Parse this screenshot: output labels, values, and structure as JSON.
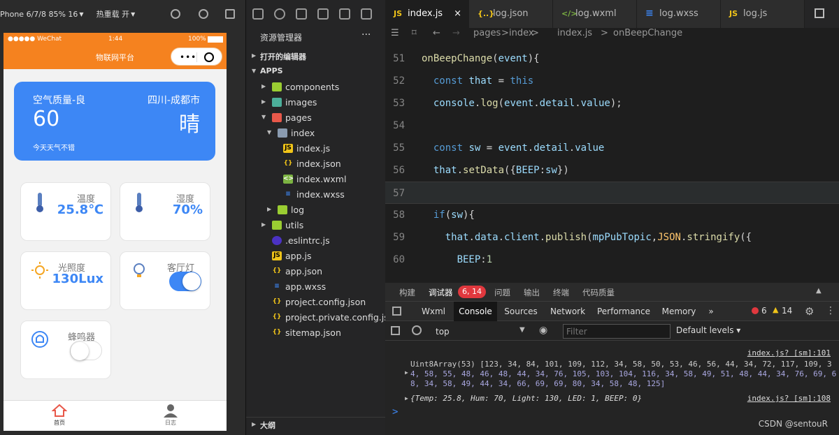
{
  "simulator": {
    "device": "Phone 6/7/8 85% 16",
    "hotreload": "热重载 开",
    "statusbar": {
      "carrier": "●●●●● WeChat",
      "time": "1:44",
      "battery": "100%"
    },
    "nav_title": "物联网平台",
    "capsule_dots": "•••",
    "weather": {
      "air": "空气质量-良",
      "city": "四川-成都市",
      "aqi": "60",
      "condition": "晴",
      "desc": "今天天气不错"
    },
    "cards": [
      {
        "label": "温度",
        "value": "25.8℃"
      },
      {
        "label": "湿度",
        "value": "70%"
      },
      {
        "label": "光照度",
        "value": "130Lux"
      },
      {
        "label": "客厅灯",
        "toggle": true
      },
      {
        "label": "蜂鸣器",
        "toggle": false
      }
    ],
    "tabs": [
      {
        "label": "首页"
      },
      {
        "label": "日志"
      }
    ],
    "colors": {
      "nav": "#f5821f",
      "accent": "#3d87f5"
    }
  },
  "explorer": {
    "title": "资源管理器",
    "more": "···",
    "open_editors": "打开的编辑器",
    "root": "APPS",
    "items": [
      {
        "name": "components"
      },
      {
        "name": "images"
      },
      {
        "name": "pages"
      },
      {
        "name": "index"
      },
      {
        "name": "index.js"
      },
      {
        "name": "index.json"
      },
      {
        "name": "index.wxml"
      },
      {
        "name": "index.wxss"
      },
      {
        "name": "log"
      },
      {
        "name": "utils"
      },
      {
        "name": ".eslintrc.js"
      },
      {
        "name": "app.js"
      },
      {
        "name": "app.json"
      },
      {
        "name": "app.wxss"
      },
      {
        "name": "project.config.json"
      },
      {
        "name": "project.private.config.js..."
      },
      {
        "name": "sitemap.json"
      }
    ],
    "outline": "大纲"
  },
  "editor": {
    "tabs": [
      {
        "label": "index.js",
        "icon": "JS"
      },
      {
        "label": "log.json",
        "icon": "{..}"
      },
      {
        "label": "log.wxml",
        "icon": "</>"
      },
      {
        "label": "log.wxss",
        "icon": "≡"
      },
      {
        "label": "log.js",
        "icon": "JS"
      }
    ],
    "close": "×",
    "breadcrumb": [
      "pages",
      "index",
      "index.js",
      "onBeepChange"
    ],
    "sep": ">",
    "code": [
      {
        "n": "51",
        "parts": [
          [
            "fn",
            "onBeepChange"
          ],
          [
            "pl",
            "("
          ],
          [
            "vr",
            "event"
          ],
          [
            "pl",
            "){"
          ]
        ]
      },
      {
        "n": "52",
        "parts": [
          [
            "pl",
            "  "
          ],
          [
            "kw",
            "const"
          ],
          [
            "pl",
            " "
          ],
          [
            "vr",
            "that"
          ],
          [
            "pl",
            " = "
          ],
          [
            "kw",
            "this"
          ]
        ]
      },
      {
        "n": "53",
        "parts": [
          [
            "pl",
            "  "
          ],
          [
            "vr",
            "console"
          ],
          [
            "pl",
            "."
          ],
          [
            "fn",
            "log"
          ],
          [
            "pl",
            "("
          ],
          [
            "vr",
            "event"
          ],
          [
            "pl",
            "."
          ],
          [
            "vr",
            "detail"
          ],
          [
            "pl",
            "."
          ],
          [
            "vr",
            "value"
          ],
          [
            "pl",
            ");"
          ]
        ]
      },
      {
        "n": "54",
        "parts": []
      },
      {
        "n": "55",
        "parts": [
          [
            "pl",
            "  "
          ],
          [
            "kw",
            "const"
          ],
          [
            "pl",
            " "
          ],
          [
            "vr",
            "sw"
          ],
          [
            "pl",
            " = "
          ],
          [
            "vr",
            "event"
          ],
          [
            "pl",
            "."
          ],
          [
            "vr",
            "detail"
          ],
          [
            "pl",
            "."
          ],
          [
            "vr",
            "value"
          ]
        ]
      },
      {
        "n": "56",
        "parts": [
          [
            "pl",
            "  "
          ],
          [
            "vr",
            "that"
          ],
          [
            "pl",
            "."
          ],
          [
            "fn",
            "setData"
          ],
          [
            "pl",
            "({"
          ],
          [
            "vr",
            "BEEP"
          ],
          [
            "pl",
            ":"
          ],
          [
            "vr",
            "sw"
          ],
          [
            "pl",
            "})"
          ]
        ]
      },
      {
        "n": "57",
        "parts": []
      },
      {
        "n": "58",
        "parts": [
          [
            "pl",
            "  "
          ],
          [
            "kw",
            "if"
          ],
          [
            "pl",
            "("
          ],
          [
            "vr",
            "sw"
          ],
          [
            "pl",
            "){"
          ]
        ]
      },
      {
        "n": "59",
        "parts": [
          [
            "pl",
            "    "
          ],
          [
            "vr",
            "that"
          ],
          [
            "pl",
            "."
          ],
          [
            "vr",
            "data"
          ],
          [
            "pl",
            "."
          ],
          [
            "vr",
            "client"
          ],
          [
            "pl",
            "."
          ],
          [
            "fn",
            "publish"
          ],
          [
            "pl",
            "("
          ],
          [
            "vr",
            "mpPubTopic"
          ],
          [
            "pl",
            ","
          ],
          [
            "cl",
            "JSON"
          ],
          [
            "pl",
            "."
          ],
          [
            "fn",
            "stringify"
          ],
          [
            "pl",
            "({"
          ]
        ]
      },
      {
        "n": "60",
        "parts": [
          [
            "pl",
            "      "
          ],
          [
            "vr",
            "BEEP"
          ],
          [
            "pl",
            ":"
          ],
          [
            "nm2",
            "1"
          ]
        ]
      }
    ]
  },
  "devtools": {
    "tabs": [
      "构建",
      "调试器",
      "问题",
      "输出",
      "终端",
      "代码质量"
    ],
    "badge": "6, 14",
    "panel_tabs": [
      "Wxml",
      "Console",
      "Sources",
      "Network",
      "Performance",
      "Memory"
    ],
    "more": "»",
    "errors": "6",
    "warnings": "14",
    "context": "top",
    "filter_placeholder": "Filter",
    "levels": "Default levels ▾",
    "messages": [
      {
        "src": "index.js? [sm]:101",
        "text": "Uint8Array(53) [123, 34, 84, 101, 109, 112, 34, 58, 50, 53, 46, 56, 44, 34, 72, 117, 109, 3"
      },
      {
        "text": "4, 58, 55, 48, 46, 48, 44, 34, 76, 105, 103, 104, 116, 34, 58, 49, 51, 48, 44, 34, 76, 69, 6"
      },
      {
        "text": "8, 34, 58, 49, 44, 34, 66, 69, 69, 80, 34, 58, 48, 125]"
      },
      {
        "src": "index.js? [sm]:108",
        "text": "{Temp: 25.8, Hum: 70, Light: 130, LED: 1, BEEP: 0}"
      }
    ],
    "prompt": ">"
  },
  "watermark": "CSDN @sentouR"
}
